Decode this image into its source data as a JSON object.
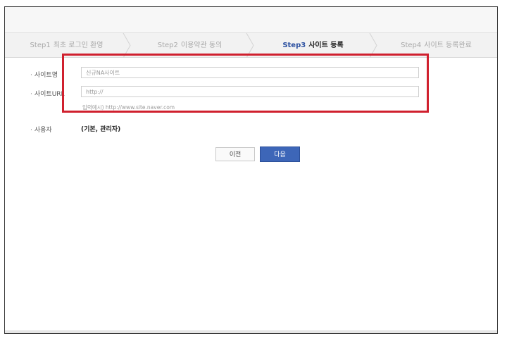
{
  "steps": [
    {
      "num": "Step1",
      "label": "최초 로그인 환영"
    },
    {
      "num": "Step2",
      "label": "이용약관 동의"
    },
    {
      "num": "Step3",
      "label": "사이트 등록"
    },
    {
      "num": "Step4",
      "label": "사이트 등록완료"
    }
  ],
  "active_step": "Step3",
  "form": {
    "site_name_label": "사이트명",
    "site_name_value": "신규NA사이트",
    "site_url_label": "사이트URL",
    "site_url_value": "http://",
    "url_hint": "입력예시) http://www.site.naver.com",
    "user_label": "사용자",
    "user_value": "(기본, 관리자)"
  },
  "buttons": {
    "prev_label": "이전",
    "next_label": "다음"
  },
  "colors": {
    "highlight": "#d0202e",
    "primary_button": "#3d66b8"
  }
}
